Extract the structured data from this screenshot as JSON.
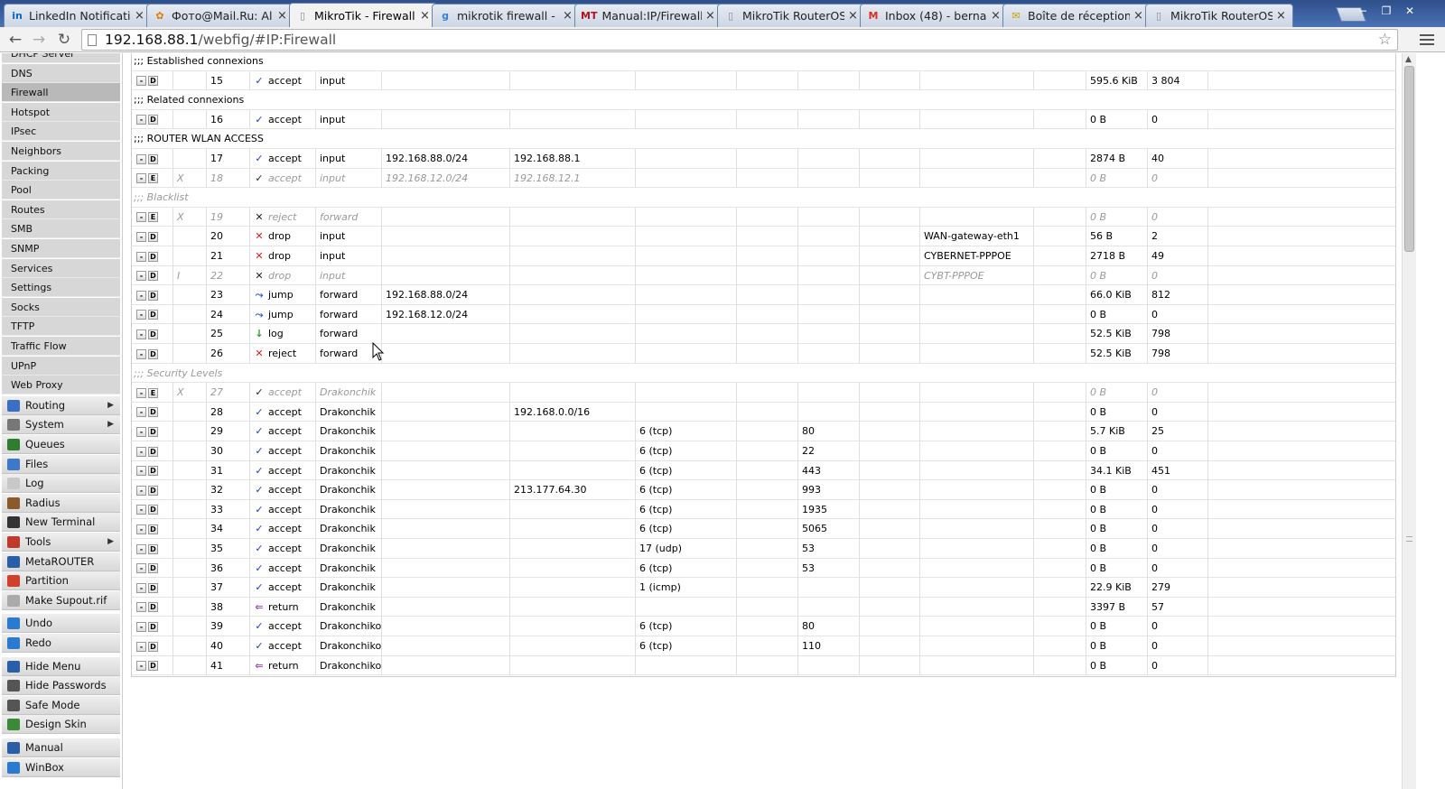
{
  "browser": {
    "tabs": [
      {
        "title": "LinkedIn Notificati",
        "fav": "in",
        "favColor": "#0a66c2",
        "x": 0
      },
      {
        "title": "Фото@Mail.Ru: Al",
        "fav": "✿",
        "favColor": "#e07b00",
        "x": 0
      },
      {
        "title": "MikroTik - Firewall",
        "fav": "▯",
        "favColor": "#888888",
        "x": 0,
        "active": true
      },
      {
        "title": "mikrotik firewall -",
        "fav": "g",
        "favColor": "#3b7ddd",
        "x": 0
      },
      {
        "title": "Manual:IP/Firewall",
        "fav": "MT",
        "favColor": "#b5121b",
        "x": 0
      },
      {
        "title": "MikroTik RouterOS",
        "fav": "▯",
        "favColor": "#888888",
        "x": 0
      },
      {
        "title": "Inbox (48) - berna",
        "fav": "M",
        "favColor": "#d93025",
        "x": 0
      },
      {
        "title": "Boîte de réception",
        "fav": "✉",
        "favColor": "#c9a100",
        "x": 0
      },
      {
        "title": "MikroTik RouterOS",
        "fav": "▯",
        "favColor": "#888888",
        "x": 0
      }
    ],
    "url_host": "192.168.88.1",
    "url_path": "/webfig/#IP:Firewall"
  },
  "sidebar": {
    "submenu": [
      "DHCP Server",
      "DNS",
      "Firewall",
      "Hotspot",
      "IPsec",
      "Neighbors",
      "Packing",
      "Pool",
      "Routes",
      "SMB",
      "SNMP",
      "Services",
      "Settings",
      "Socks",
      "TFTP",
      "Traffic Flow",
      "UPnP",
      "Web Proxy"
    ],
    "active_submenu": "Firewall",
    "main": [
      {
        "label": "Routing",
        "icon": "routing-icon",
        "color": "#3a6fc4",
        "arrow": true
      },
      {
        "label": "System",
        "icon": "system-icon",
        "color": "#777777",
        "arrow": true
      },
      {
        "label": "Queues",
        "icon": "queues-icon",
        "color": "#2f7d2f"
      },
      {
        "label": "Files",
        "icon": "folder-icon",
        "color": "#3f77c9"
      },
      {
        "label": "Log",
        "icon": "log-icon",
        "color": "#c8c8c8"
      },
      {
        "label": "Radius",
        "icon": "radius-icon",
        "color": "#8a5a2c"
      },
      {
        "label": "New Terminal",
        "icon": "terminal-icon",
        "color": "#333333"
      },
      {
        "label": "Tools",
        "icon": "tools-icon",
        "color": "#c0392b",
        "arrow": true
      },
      {
        "label": "MetaROUTER",
        "icon": "metarouter-icon",
        "color": "#2a5fa8"
      },
      {
        "label": "Partition",
        "icon": "partition-icon",
        "color": "#d0402a"
      },
      {
        "label": "Make Supout.rif",
        "icon": "supout-icon",
        "color": "#aaaaaa"
      },
      {
        "label": "Undo",
        "icon": "undo-icon",
        "color": "#2a7bd0",
        "sep": true
      },
      {
        "label": "Redo",
        "icon": "redo-icon",
        "color": "#2a7bd0"
      },
      {
        "label": "Hide Menu",
        "icon": "hide-menu-icon",
        "color": "#2a5fa8",
        "sep": true
      },
      {
        "label": "Hide Passwords",
        "icon": "hide-passwords-icon",
        "color": "#555555"
      },
      {
        "label": "Safe Mode",
        "icon": "safe-mode-icon",
        "color": "#555555"
      },
      {
        "label": "Design Skin",
        "icon": "design-skin-icon",
        "color": "#3a8a3a"
      },
      {
        "label": "Manual",
        "icon": "manual-icon",
        "color": "#2a5fa8",
        "sep": true
      },
      {
        "label": "WinBox",
        "icon": "winbox-icon",
        "color": "#2a7bd0"
      }
    ]
  },
  "rules": [
    {
      "comment": ";;; Established connexions"
    },
    {
      "btn2": "D",
      "num": "15",
      "action": "accept",
      "chain": "input",
      "bytes": "595.6 KiB",
      "packets": "3 804"
    },
    {
      "comment": ";;; Related connexions"
    },
    {
      "btn2": "D",
      "num": "16",
      "action": "accept",
      "chain": "input",
      "bytes": "0 B",
      "packets": "0"
    },
    {
      "comment": ";;; ROUTER WLAN ACCESS"
    },
    {
      "btn2": "D",
      "num": "17",
      "action": "accept",
      "chain": "input",
      "src": "192.168.88.0/24",
      "dst": "192.168.88.1",
      "bytes": "2874 B",
      "packets": "40"
    },
    {
      "btn2": "E",
      "flag": "X",
      "num": "18",
      "action": "accept",
      "chain": "input",
      "src": "192.168.12.0/24",
      "dst": "192.168.12.1",
      "bytes": "0 B",
      "packets": "0",
      "disabled": true
    },
    {
      "comment": ";;; Blacklist",
      "disabled": true
    },
    {
      "btn2": "E",
      "flag": "X",
      "num": "19",
      "action": "reject",
      "chain": "forward",
      "bytes": "0 B",
      "packets": "0",
      "disabled": true
    },
    {
      "btn2": "D",
      "num": "20",
      "action": "drop",
      "chain": "input",
      "iface": "WAN-gateway-eth1",
      "bytes": "56 B",
      "packets": "2"
    },
    {
      "btn2": "D",
      "num": "21",
      "action": "drop",
      "chain": "input",
      "iface": "CYBERNET-PPPOE",
      "bytes": "2718 B",
      "packets": "49"
    },
    {
      "btn2": "D",
      "flag": "I",
      "num": "22",
      "action": "drop",
      "chain": "input",
      "iface": "CYBT-PPPOE",
      "bytes": "0 B",
      "packets": "0",
      "disabled": true
    },
    {
      "btn2": "D",
      "num": "23",
      "action": "jump",
      "chain": "forward",
      "src": "192.168.88.0/24",
      "bytes": "66.0 KiB",
      "packets": "812"
    },
    {
      "btn2": "D",
      "num": "24",
      "action": "jump",
      "chain": "forward",
      "src": "192.168.12.0/24",
      "bytes": "0 B",
      "packets": "0"
    },
    {
      "btn2": "D",
      "num": "25",
      "action": "log",
      "chain": "forward",
      "bytes": "52.5 KiB",
      "packets": "798"
    },
    {
      "btn2": "D",
      "num": "26",
      "action": "reject",
      "chain": "forward",
      "bytes": "52.5 KiB",
      "packets": "798"
    },
    {
      "comment": ";;; Security Levels",
      "disabled": true
    },
    {
      "btn2": "E",
      "flag": "X",
      "num": "27",
      "action": "accept",
      "chain": "Drakonchik",
      "bytes": "0 B",
      "packets": "0",
      "disabled": true
    },
    {
      "btn2": "D",
      "num": "28",
      "action": "accept",
      "chain": "Drakonchik",
      "dst": "192.168.0.0/16",
      "bytes": "0 B",
      "packets": "0"
    },
    {
      "btn2": "D",
      "num": "29",
      "action": "accept",
      "chain": "Drakonchik",
      "proto": "6 (tcp)",
      "dport": "80",
      "bytes": "5.7 KiB",
      "packets": "25"
    },
    {
      "btn2": "D",
      "num": "30",
      "action": "accept",
      "chain": "Drakonchik",
      "proto": "6 (tcp)",
      "dport": "22",
      "bytes": "0 B",
      "packets": "0"
    },
    {
      "btn2": "D",
      "num": "31",
      "action": "accept",
      "chain": "Drakonchik",
      "proto": "6 (tcp)",
      "dport": "443",
      "bytes": "34.1 KiB",
      "packets": "451"
    },
    {
      "btn2": "D",
      "num": "32",
      "action": "accept",
      "chain": "Drakonchik",
      "dst": "213.177.64.30",
      "proto": "6 (tcp)",
      "dport": "993",
      "bytes": "0 B",
      "packets": "0"
    },
    {
      "btn2": "D",
      "num": "33",
      "action": "accept",
      "chain": "Drakonchik",
      "proto": "6 (tcp)",
      "dport": "1935",
      "bytes": "0 B",
      "packets": "0"
    },
    {
      "btn2": "D",
      "num": "34",
      "action": "accept",
      "chain": "Drakonchik",
      "proto": "6 (tcp)",
      "dport": "5065",
      "bytes": "0 B",
      "packets": "0"
    },
    {
      "btn2": "D",
      "num": "35",
      "action": "accept",
      "chain": "Drakonchik",
      "proto": "17 (udp)",
      "dport": "53",
      "bytes": "0 B",
      "packets": "0"
    },
    {
      "btn2": "D",
      "num": "36",
      "action": "accept",
      "chain": "Drakonchik",
      "proto": "6 (tcp)",
      "dport": "53",
      "bytes": "0 B",
      "packets": "0"
    },
    {
      "btn2": "D",
      "num": "37",
      "action": "accept",
      "chain": "Drakonchik",
      "proto": "1 (icmp)",
      "bytes": "22.9 KiB",
      "packets": "279"
    },
    {
      "btn2": "D",
      "num": "38",
      "action": "return",
      "chain": "Drakonchik",
      "bytes": "3397 B",
      "packets": "57"
    },
    {
      "btn2": "D",
      "num": "39",
      "action": "accept",
      "chain": "Drakonchikov",
      "proto": "6 (tcp)",
      "dport": "80",
      "bytes": "0 B",
      "packets": "0"
    },
    {
      "btn2": "D",
      "num": "40",
      "action": "accept",
      "chain": "Drakonchikov",
      "proto": "6 (tcp)",
      "dport": "110",
      "bytes": "0 B",
      "packets": "0"
    },
    {
      "btn2": "D",
      "num": "41",
      "action": "return",
      "chain": "Drakonchikov",
      "bytes": "0 B",
      "packets": "0"
    }
  ],
  "action_icons": {
    "accept": {
      "glyph": "✓",
      "color": "#1d3fb8",
      "name": "accept-check-icon"
    },
    "reject": {
      "glyph": "✕",
      "color": "#d22020",
      "name": "reject-x-icon"
    },
    "drop": {
      "glyph": "✕",
      "color": "#d22020",
      "name": "drop-x-icon"
    },
    "jump": {
      "glyph": "⤳",
      "color": "#2a5fc8",
      "name": "jump-arrow-icon"
    },
    "log": {
      "glyph": "↓",
      "color": "#2a9a2a",
      "name": "log-arrow-icon"
    },
    "return": {
      "glyph": "⇐",
      "color": "#a040c0",
      "name": "return-arrow-icon"
    }
  }
}
